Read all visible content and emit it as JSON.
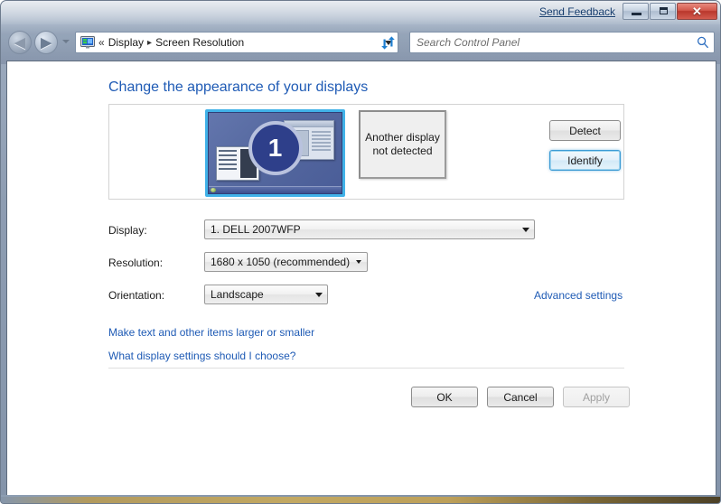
{
  "window": {
    "send_feedback": "Send Feedback",
    "controls": {
      "minimize": "minimize-button",
      "maximize": "maximize-button",
      "close_glyph": "✕"
    }
  },
  "navigation": {
    "back": "back-button",
    "forward": "forward-button",
    "recent_pages": "recent-pages-chevron",
    "breadcrumb": {
      "separator_double": "«",
      "separator": "▸",
      "items": [
        {
          "label": "Display"
        },
        {
          "label": "Screen Resolution"
        }
      ]
    },
    "address_dropdown": "address-dropdown",
    "refresh": "refresh-button"
  },
  "search": {
    "placeholder": "Search Control Panel",
    "icon": "search-icon"
  },
  "main": {
    "heading": "Change the appearance of your displays",
    "preview": {
      "monitor": {
        "number": "1",
        "selected": true
      },
      "no_display_text": "Another display\nnot detected",
      "no_display_line1": "Another display",
      "no_display_line2": "not detected"
    },
    "buttons": {
      "detect": "Detect",
      "identify": "Identify"
    },
    "fields": [
      {
        "label": "Display:",
        "value": "1. DELL 2007WFP"
      },
      {
        "label": "Resolution:",
        "value": "1680 x 1050 (recommended)"
      },
      {
        "label": "Orientation:",
        "value": "Landscape"
      }
    ],
    "links": {
      "advanced_settings": "Advanced settings",
      "make_text_larger": "Make text and other items larger or smaller",
      "what_settings": "What display settings should I choose?"
    },
    "footer": {
      "ok": "OK",
      "cancel": "Cancel",
      "apply": "Apply"
    }
  },
  "colors": {
    "link_blue": "#1f5bb5",
    "heading_blue": "#1f5bb5",
    "selection_border": "#41b2e8",
    "monitor_blue": "#4e61a0",
    "frame_gold": "#c2a862"
  }
}
